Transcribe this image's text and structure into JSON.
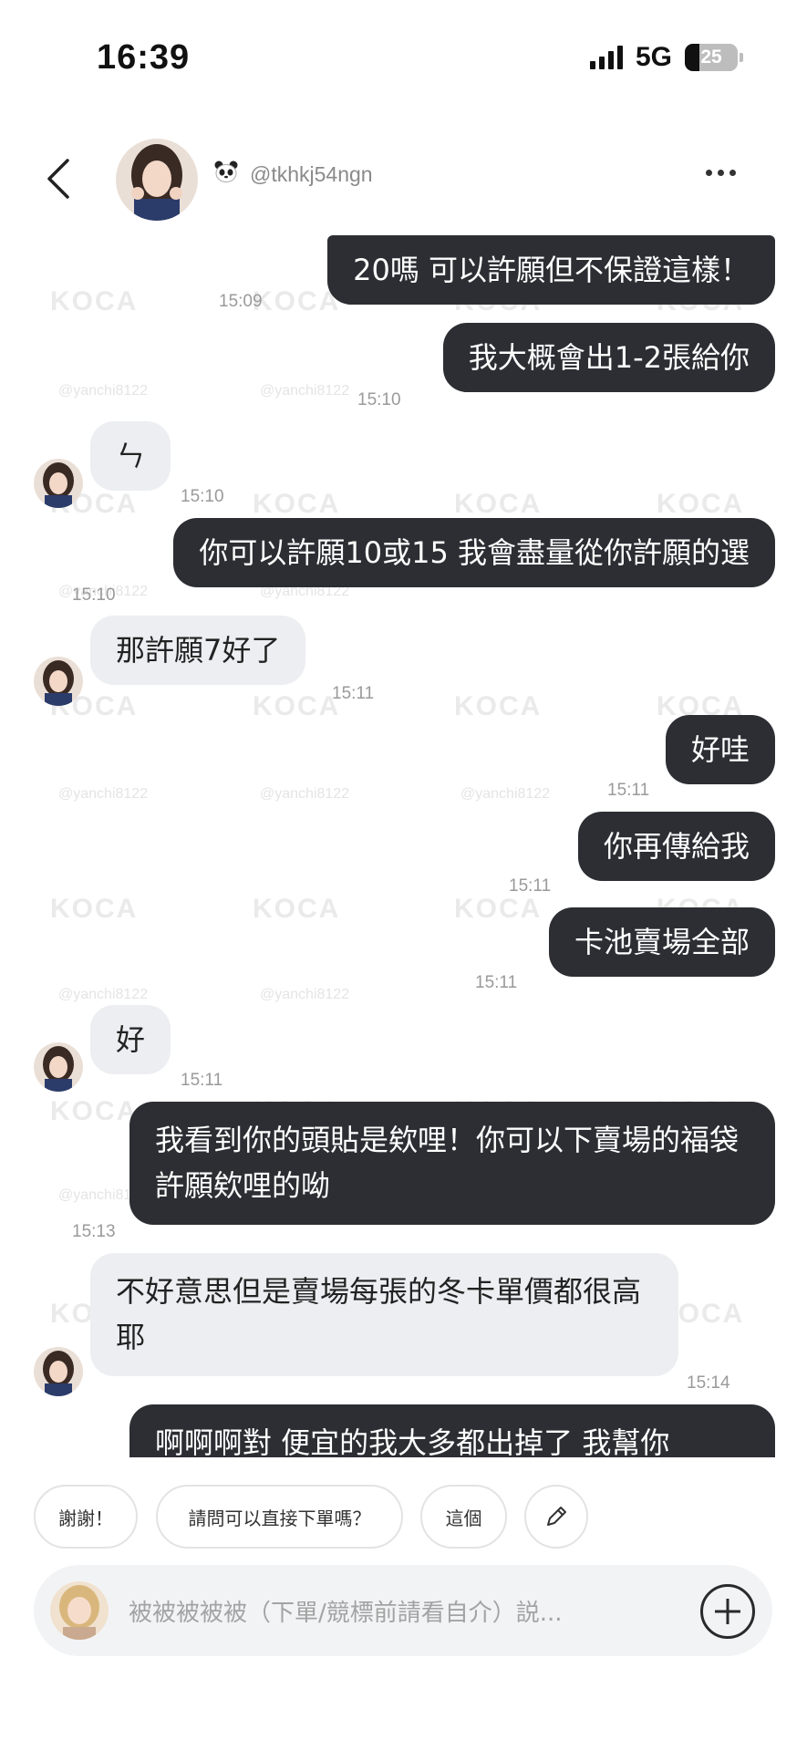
{
  "status": {
    "time": "16:39",
    "network": "5G",
    "battery": "25"
  },
  "header": {
    "username": "@tkhkj54ngn"
  },
  "watermark": {
    "logo": "KOCA",
    "handle": "@yanchi8122"
  },
  "messages": [
    {
      "text": "20嗎 可以許願但不保證這樣！",
      "time": "15:09"
    },
    {
      "text": "我大概會出1-2張給你",
      "time": "15:10"
    },
    {
      "text": "ㄣ",
      "time": "15:10"
    },
    {
      "text": "你可以許願10或15 我會盡量從你許願的選",
      "time": "15:10"
    },
    {
      "text": "那許願7好了",
      "time": "15:11"
    },
    {
      "text": "好哇",
      "time": "15:11"
    },
    {
      "text": "你再傳給我",
      "time": "15:11"
    },
    {
      "text": "卡池賣場全部",
      "time": "15:11"
    },
    {
      "text": "好",
      "time": "15:11"
    },
    {
      "text": "我看到你的頭貼是欸哩！你可以下賣場的福袋許願欸哩的呦",
      "time": "15:13"
    },
    {
      "text": "不好意思但是賣場每張的冬卡單價都很高耶",
      "time": "15:14"
    },
    {
      "text": "啊啊啊對 便宜的我大多都出掉了 我幫你"
    }
  ],
  "quick_replies": [
    "謝謝！",
    "請問可以直接下單嗎？",
    "這個"
  ],
  "input": {
    "placeholder": "被被被被被（下單/競標前請看自介）説..."
  }
}
